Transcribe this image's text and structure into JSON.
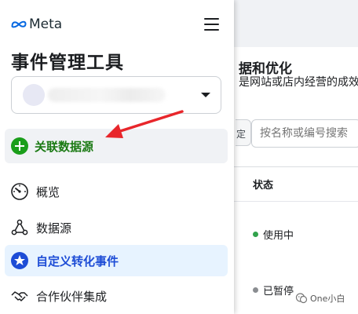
{
  "brand": {
    "name": "Meta"
  },
  "sidebar": {
    "app_title": "事件管理工具",
    "connect_label": "关联数据源",
    "nav": [
      {
        "label": "概览",
        "icon": "gauge-icon",
        "active": false
      },
      {
        "label": "数据源",
        "icon": "data-sources-icon",
        "active": false
      },
      {
        "label": "自定义转化事件",
        "icon": "star-badge-icon",
        "active": true
      },
      {
        "label": "合作伙伴集成",
        "icon": "handshake-icon",
        "active": false
      }
    ]
  },
  "main": {
    "heading": "据和优化",
    "subheading": "是网站或店内经营的成效，",
    "filter_stub": "定",
    "search_placeholder": "按名称或编号搜索",
    "column_status": "状态",
    "rows": [
      {
        "status": "使用中",
        "status_color": "#31a24c"
      },
      {
        "status": "已暂停",
        "status_color": "#8a8d91"
      }
    ]
  },
  "watermark": {
    "text": "One小白"
  },
  "colors": {
    "accent": "#1d4cd6",
    "active_bg": "#e7f3ff",
    "connect_green": "#1b7a14",
    "annotation_arrow": "#e8262b"
  }
}
